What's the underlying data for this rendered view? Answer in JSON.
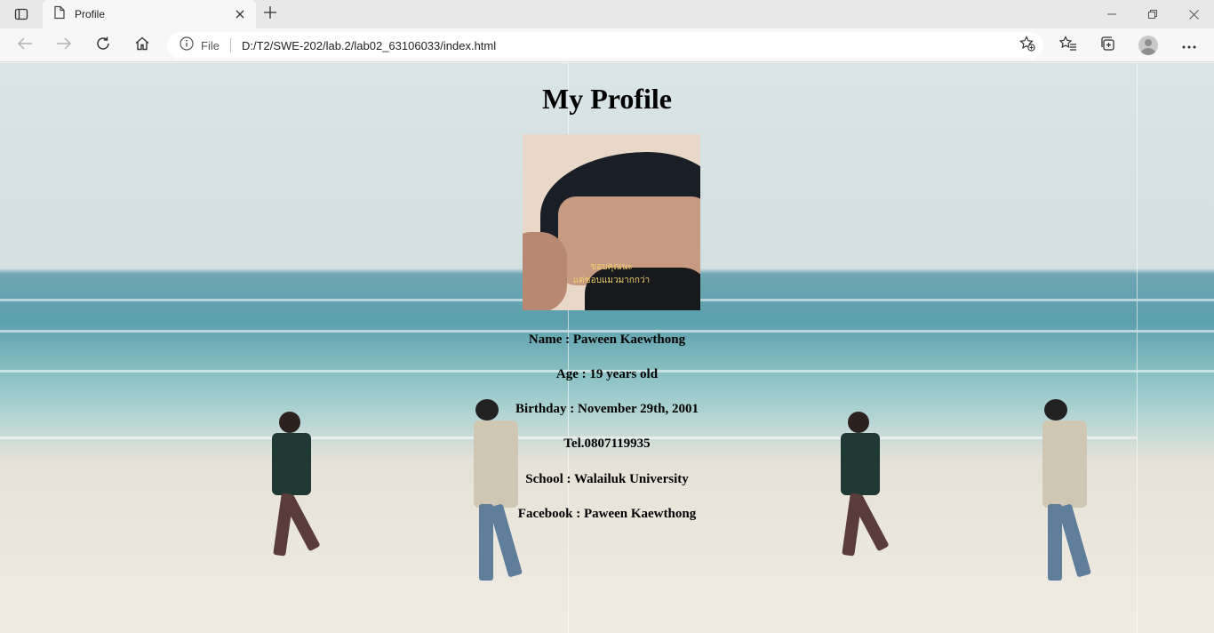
{
  "browser": {
    "tab_title": "Profile",
    "address": {
      "scheme_label": "File",
      "url": "D:/T2/SWE-202/lab.2/lab02_63106033/index.html"
    }
  },
  "page": {
    "heading": "My Profile",
    "photo_caption": [
      "ขอบคุณนะ",
      "แต่ชอบแมวมากกว่า"
    ],
    "info": [
      "Name : Paween Kaewthong",
      "Age : 19 years old",
      "Birthday : November 29th, 2001",
      "Tel.0807119935",
      "School : Walailuk University",
      "Facebook : Paween Kaewthong"
    ]
  },
  "icons": {
    "tab_actions": "tab-actions-icon",
    "page": "page-icon",
    "close": "close-icon",
    "new_tab": "plus-icon",
    "back": "back-arrow-icon",
    "forward": "forward-arrow-icon",
    "refresh": "refresh-icon",
    "home": "home-icon",
    "info": "info-icon",
    "add_favorite": "star-plus-icon",
    "favorites": "favorites-icon",
    "collections": "collections-icon",
    "profile": "avatar",
    "menu": "more-icon"
  },
  "colors": {
    "chrome_bg": "#f7f7f7",
    "tab_strip_bg": "#e8e8e8",
    "caption_yellow": "#f2d26b"
  }
}
